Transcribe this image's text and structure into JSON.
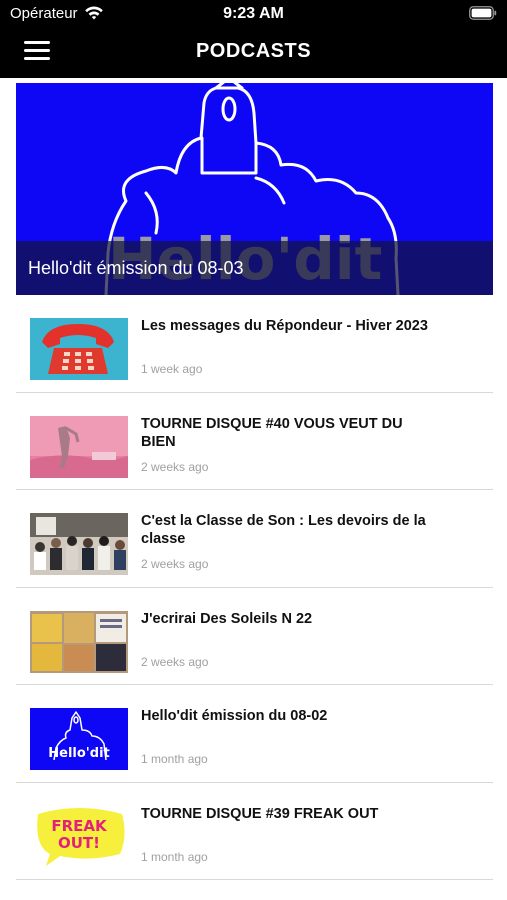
{
  "status": {
    "carrier": "Opérateur",
    "time": "9:23 AM"
  },
  "nav": {
    "title": "PODCASTS"
  },
  "hero": {
    "logo_text": "Hello'dit",
    "caption": "Hello'dit émission du 08-03",
    "bg_color": "#0d07f5"
  },
  "episodes": [
    {
      "title": "Les messages du Répondeur - Hiver 2023",
      "date": "1 week ago"
    },
    {
      "title": "TOURNE DISQUE #40 VOUS VEUT DU BIEN",
      "date": "2 weeks ago"
    },
    {
      "title": "C'est la Classe de Son : Les devoirs de la classe",
      "date": "2 weeks ago"
    },
    {
      "title": "J'ecrirai Des Soleils N 22",
      "date": "2 weeks ago"
    },
    {
      "title": "Hello'dit émission du 08-02",
      "date": "1 month ago",
      "thumb_text": "Hello'dit"
    },
    {
      "title": "TOURNE DISQUE #39 FREAK OUT",
      "date": "1 month ago",
      "thumb_text_1": "FREAK",
      "thumb_text_2": "OUT!"
    }
  ]
}
